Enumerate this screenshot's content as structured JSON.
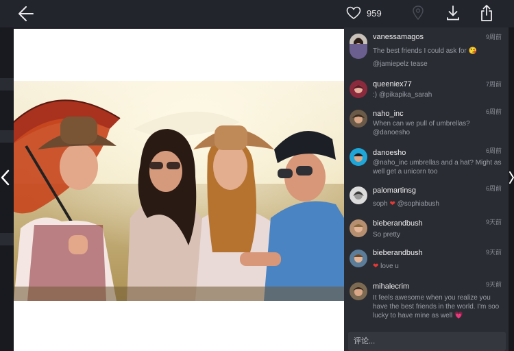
{
  "toolbar": {
    "like_count": "959",
    "icons": [
      "back-arrow-icon",
      "heart-icon",
      "location-pin-icon",
      "download-icon",
      "share-icon"
    ]
  },
  "colors": {
    "background": "#1e1f26",
    "topbar": "#23252d",
    "panel": "#2a2c33",
    "text_primary": "#f0f0f2",
    "text_secondary": "#9a9da6",
    "heart_red": "#e53935",
    "heart_pink": "#ff6fae"
  },
  "comments": [
    {
      "username": "vanessamagos",
      "time": "9周前",
      "text": "The best friends I could ask for 😘"
    },
    {
      "username": "",
      "time": "",
      "text": "@jamiepelz tease"
    },
    {
      "username": "queeniex77",
      "time": "7周前",
      "text": ":) @pikapika_sarah"
    },
    {
      "username": "naho_inc",
      "time": "6周前",
      "text": "When can we pull of umbrellas? @danoesho"
    },
    {
      "username": "danoesho",
      "time": "6周前",
      "text": "@naho_inc umbrellas and a hat? Might as well get a unicorn too"
    },
    {
      "username": "palomartinsg",
      "time": "6周前",
      "text_before": "soph ",
      "heart": "❤",
      "text_after": " @sophiabush"
    },
    {
      "username": "bieberandbush",
      "time": "9天前",
      "text": "So pretty"
    },
    {
      "username": "bieberandbush",
      "time": "9天前",
      "heart": "❤",
      "text_after": " love u"
    },
    {
      "username": "mihalecrim",
      "time": "9天前",
      "text": "It feels awesome when you realize you have the best friends in the world. I'm soo lucky to have mine as well ",
      "heart": "💗"
    }
  ],
  "input": {
    "placeholder": "评论..."
  }
}
